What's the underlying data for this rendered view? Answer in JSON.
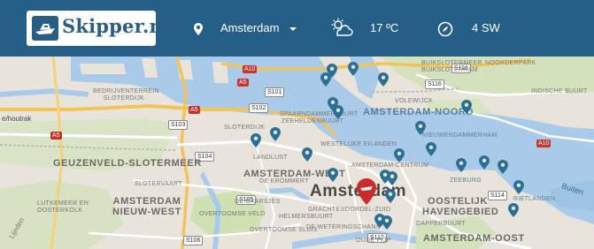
{
  "header": {
    "logo_text": "Skipper.nl",
    "city": "Amsterdam",
    "temperature": "17 ºC",
    "wind": "4 SW",
    "colors": {
      "bar": "#255e86",
      "text": "#ffffff"
    }
  },
  "map": {
    "city_label": "Amsterdam",
    "districts": [
      "GEUZENVELD-SLOTERMEER",
      "AMSTERDAM-NOORD",
      "AMSTERDAM-WEST",
      "AMSTERDAM NIEUW-WEST",
      "OOSTELIJK HAVENGEBIED",
      "AMSTERDAM-OOST"
    ],
    "places": [
      "BEDRIJVENTERREIN SLOTERDIJK",
      "SLOTERDIJK",
      "SPAARNDAMMERBUURT",
      "ZEEHELDENBUURT",
      "VOLEWIJCK",
      "BUIKSLOTERMEER",
      "BUIKSLOTERHAM",
      "LANDLUST",
      "WESTELIJKE EILANDEN",
      "INDISCHE BUURT",
      "DE KROMMERT",
      "SLOTERVAART",
      "LUTKEMEER EN OOSTERKOLK",
      "OVERTOOMSE VELD",
      "DE BAARSJES",
      "HELMERSBUURT",
      "OVERTOOMSE SLUIS",
      "GRACHTENGORDEL-ZUID",
      "DE WETERINGSCHANS",
      "ZEEBURG",
      "DAPPERBUURT",
      "NIEUWENDAMMERHAM",
      "NOORDERPARK",
      "AMSTERDAM-CENTRUM",
      "OUDE PIJP",
      "RIETLANDEN"
    ],
    "edge_labels": {
      "left": "e/houtrak",
      "right": "Buiten",
      "far_left_road": "Lijnden"
    },
    "roads": {
      "a10_north": "A10",
      "a5_a": "A5",
      "a5_b": "A5",
      "a5_c": "A5",
      "a10_east": "A10",
      "s101": "S101",
      "s102": "S102",
      "s103": "S103",
      "s104": "S104",
      "s105": "S105",
      "s106": "S106",
      "s116": "S116",
      "s118": "S118",
      "s112": "S112",
      "s114": "S114"
    },
    "colors": {
      "water": "#a6c8e8",
      "land": "#e9e4db",
      "green": "#c6dba7",
      "pin": "#2b6f96",
      "active_pin": "#cc2b2b"
    },
    "pins": 24,
    "active_pin": 1
  }
}
